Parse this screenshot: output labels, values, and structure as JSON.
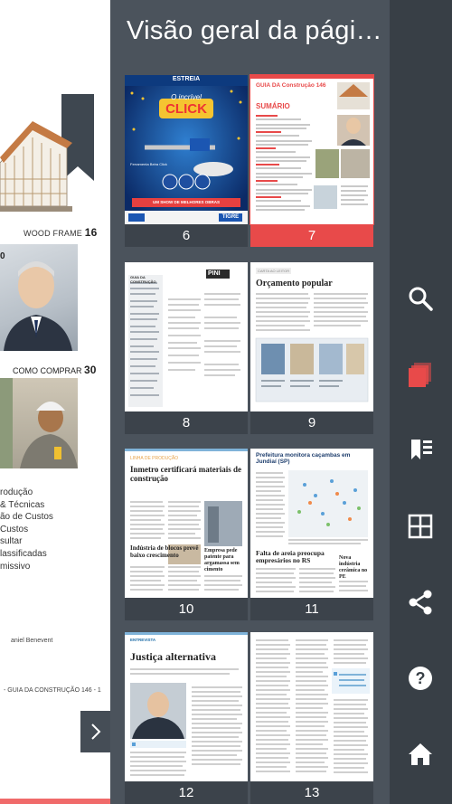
{
  "panel": {
    "title": "Visão geral da pági…"
  },
  "background_page": {
    "wood_frame_label": "WOOD FRAME",
    "wood_frame_page": "16",
    "partial_number": "0",
    "como_comprar_label": "COMO COMPRAR",
    "como_comprar_page": "30",
    "toc_items": [
      "rodução",
      "& Técnicas",
      "ão de Custos",
      "Custos",
      "sultar",
      "lassificadas",
      "missivo"
    ],
    "byline": "aniel Benevent",
    "footer": "- GUIA DA CONSTRUÇÃO 146 -",
    "footer_page": "1"
  },
  "thumbnails": [
    {
      "page": "6",
      "selected": false,
      "kind": "cover",
      "brand": "ESTREIA",
      "headline_top": "O incrível",
      "headline_main": "CLICK",
      "sub": "Ferramenta Beira Click",
      "badge": "TIGRE",
      "banner": "UM SHOW DE MELHORES OBRAS"
    },
    {
      "page": "7",
      "selected": true,
      "kind": "toc",
      "masthead": "GUIA DA Construção 146",
      "heading": "SUMÁRIO"
    },
    {
      "page": "8",
      "selected": false,
      "kind": "expediente",
      "brand": "PINI",
      "heading": "GUIA DA CONSTRUÇÃO"
    },
    {
      "page": "9",
      "selected": false,
      "kind": "letter",
      "kicker": "CARTA AO LEITOR",
      "heading": "Orçamento popular"
    },
    {
      "page": "10",
      "selected": false,
      "kind": "article",
      "kicker": "LINHA DE PRODUÇÃO",
      "heading": "Inmetro certificará materiais de construção",
      "subheading": "Indústria de blocos prevê baixo crescimento",
      "side_heading": "Empresa pede patente para argamassa sem cimento"
    },
    {
      "page": "11",
      "selected": false,
      "kind": "article",
      "heading": "Prefeitura monitora caçambas em Jundiaí (SP)",
      "subheading": "Falta de areia preocupa empresários no RS",
      "side_heading": "Nova indústria cerâmica no PE"
    },
    {
      "page": "12",
      "selected": false,
      "kind": "interview",
      "kicker": "ENTREVISTA",
      "heading": "Justiça alternativa"
    },
    {
      "page": "13",
      "selected": false,
      "kind": "text"
    }
  ],
  "toolbar": {
    "items": [
      {
        "id": "search",
        "icon": "search-icon"
      },
      {
        "id": "pages",
        "icon": "pages-icon"
      },
      {
        "id": "bookmark",
        "icon": "bookmark-icon"
      },
      {
        "id": "grid",
        "icon": "grid-icon"
      },
      {
        "id": "share",
        "icon": "share-icon"
      },
      {
        "id": "help",
        "icon": "help-icon"
      },
      {
        "id": "home",
        "icon": "home-icon"
      }
    ],
    "active_color": "#e84a4a",
    "icon_color": "#ffffff"
  },
  "next_button": {
    "icon": "chevron-right-icon"
  }
}
